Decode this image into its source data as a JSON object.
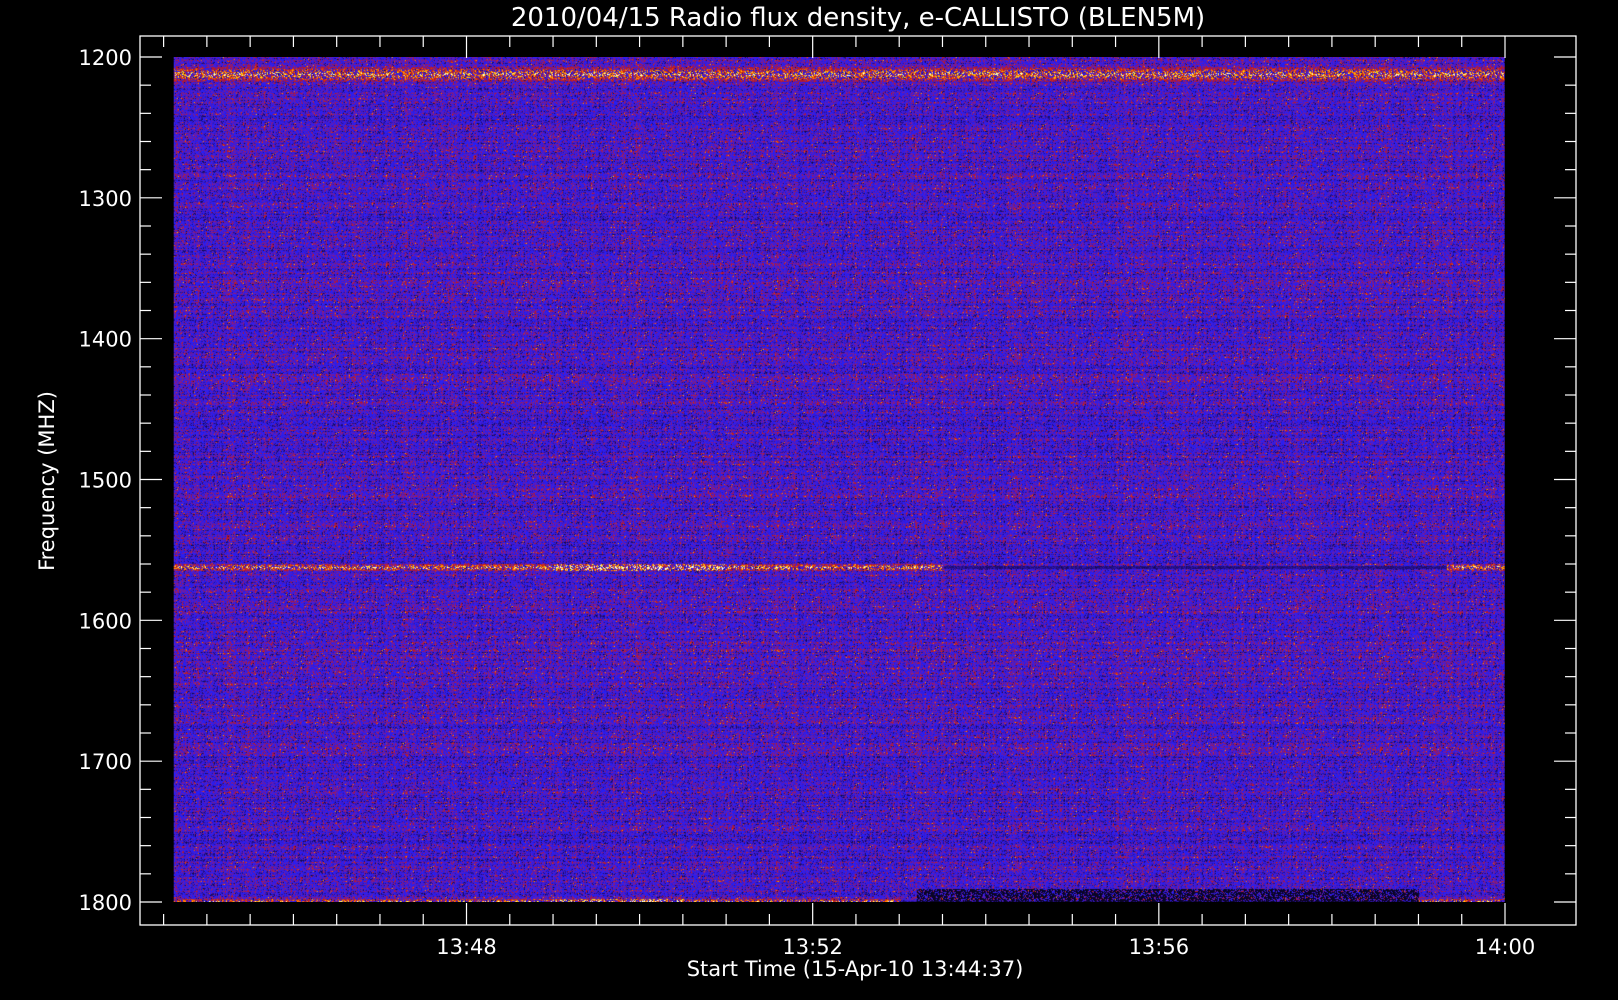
{
  "chart_data": {
    "type": "heatmap",
    "title": "2010/04/15  Radio flux density, e-CALLISTO (BLEN5M)",
    "xlabel": "Start Time (15-Apr-10 13:44:37)",
    "ylabel": "Frequency (MHZ)",
    "ylim": [
      1800,
      1200
    ],
    "xlim": [
      "13:44:37",
      "14:00:00"
    ],
    "y_ticks": [
      1200,
      1300,
      1400,
      1500,
      1600,
      1700,
      1800
    ],
    "y_tick_labels": [
      "1200",
      "1300",
      "1400",
      "1500",
      "1600",
      "1700",
      "1800"
    ],
    "x_ticks": [
      "13:48",
      "13:52",
      "13:56",
      "14:00"
    ],
    "x_tick_labels": [
      "13:48",
      "13:52",
      "13:56",
      "14:00"
    ],
    "grid": false,
    "colormap": [
      "#000000",
      "#1a0a60",
      "#3a1ad0",
      "#2020ff",
      "#7a1a9a",
      "#c01818",
      "#ff6a00",
      "#ffd000",
      "#ffffd0"
    ],
    "background_level": "blue/purple noise (low flux) across 1200-1800 MHz",
    "bright_bands": [
      {
        "frequency_mhz": 1212,
        "extent": "13:44:37-14:00:00",
        "intensity": "high, intermittent"
      },
      {
        "frequency_mhz": 1562,
        "extent": "13:44:37-13:53:30 and 13:59:20-14:00:00",
        "intensity": "high (peak 13:49-13:51)"
      },
      {
        "frequency_mhz": 1800,
        "extent": "13:44:37-13:53:00 and 13:59:00-14:00:00",
        "intensity": "high"
      }
    ]
  }
}
